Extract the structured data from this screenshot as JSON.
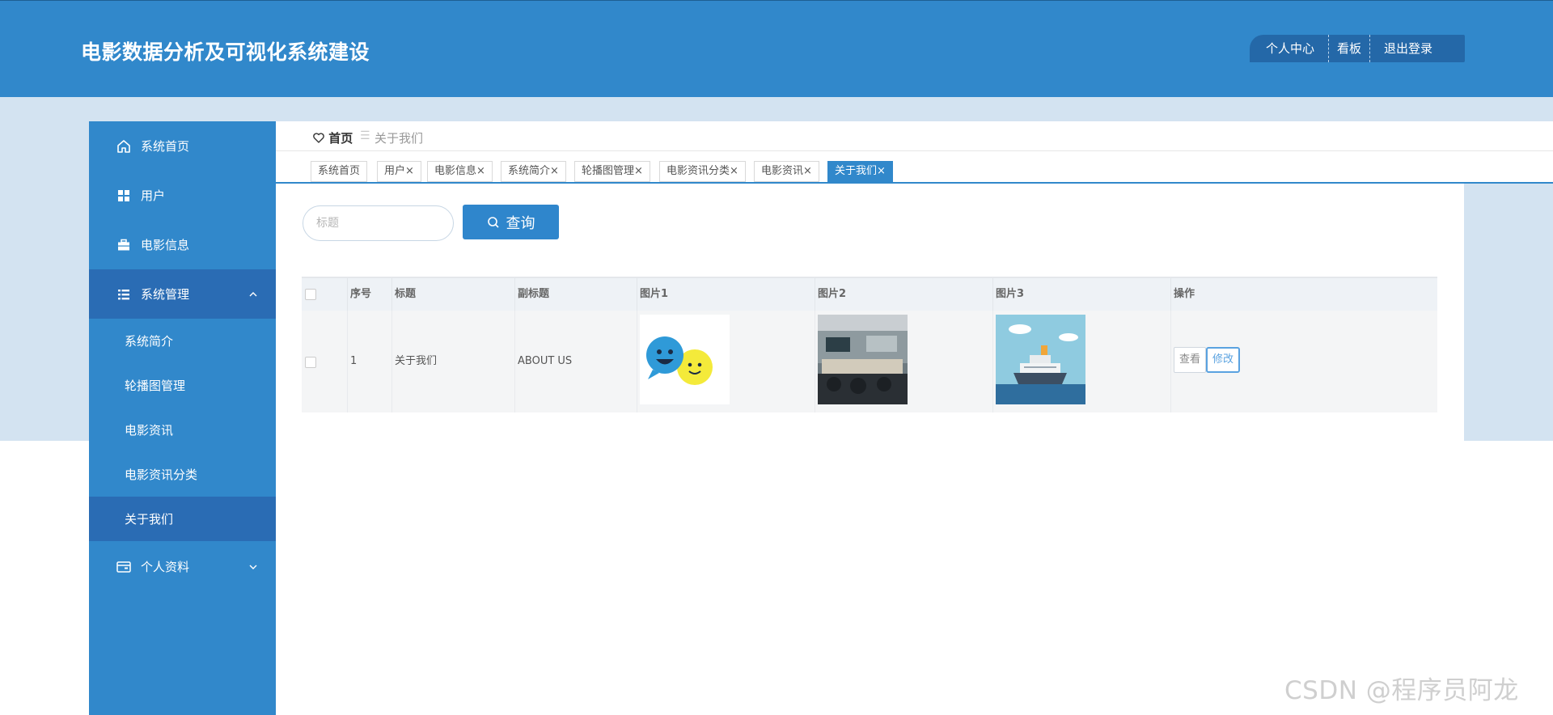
{
  "app": {
    "title": "电影数据分析及可视化系统建设"
  },
  "top_nav": {
    "items": [
      "个人中心",
      "看板",
      "退出登录"
    ]
  },
  "sidebar": {
    "items": [
      {
        "label": "系统首页",
        "icon": "home-icon"
      },
      {
        "label": "用户",
        "icon": "grid-icon"
      },
      {
        "label": "电影信息",
        "icon": "briefcase-icon"
      },
      {
        "label": "系统管理",
        "icon": "list-icon",
        "expanded": true
      },
      {
        "label": "个人资料",
        "icon": "wallet-icon",
        "expanded": false
      }
    ],
    "sub_items": [
      "系统简介",
      "轮播图管理",
      "电影资讯",
      "电影资讯分类",
      "关于我们"
    ]
  },
  "breadcrumb": {
    "home": "首页",
    "current": "关于我们"
  },
  "tabs": [
    "系统首页",
    "用户",
    "电影信息",
    "系统简介",
    "轮播图管理",
    "电影资讯分类",
    "电影资讯",
    "关于我们"
  ],
  "tab_close": "×",
  "active_tab": "关于我们",
  "search": {
    "placeholder": "标题",
    "value": "",
    "button_label": "查询"
  },
  "table": {
    "headers": [
      "序号",
      "标题",
      "副标题",
      "图片1",
      "图片2",
      "图片3",
      "操作"
    ],
    "rows": [
      {
        "index": "1",
        "title": "关于我们",
        "subtitle": "ABOUT US",
        "actions": [
          "查看",
          "修改"
        ]
      }
    ]
  },
  "colors": {
    "primary": "#3188cb",
    "active_nav": "#2a6cb4",
    "band": "#d3e3f1"
  },
  "watermark": "CSDN @程序员阿龙"
}
